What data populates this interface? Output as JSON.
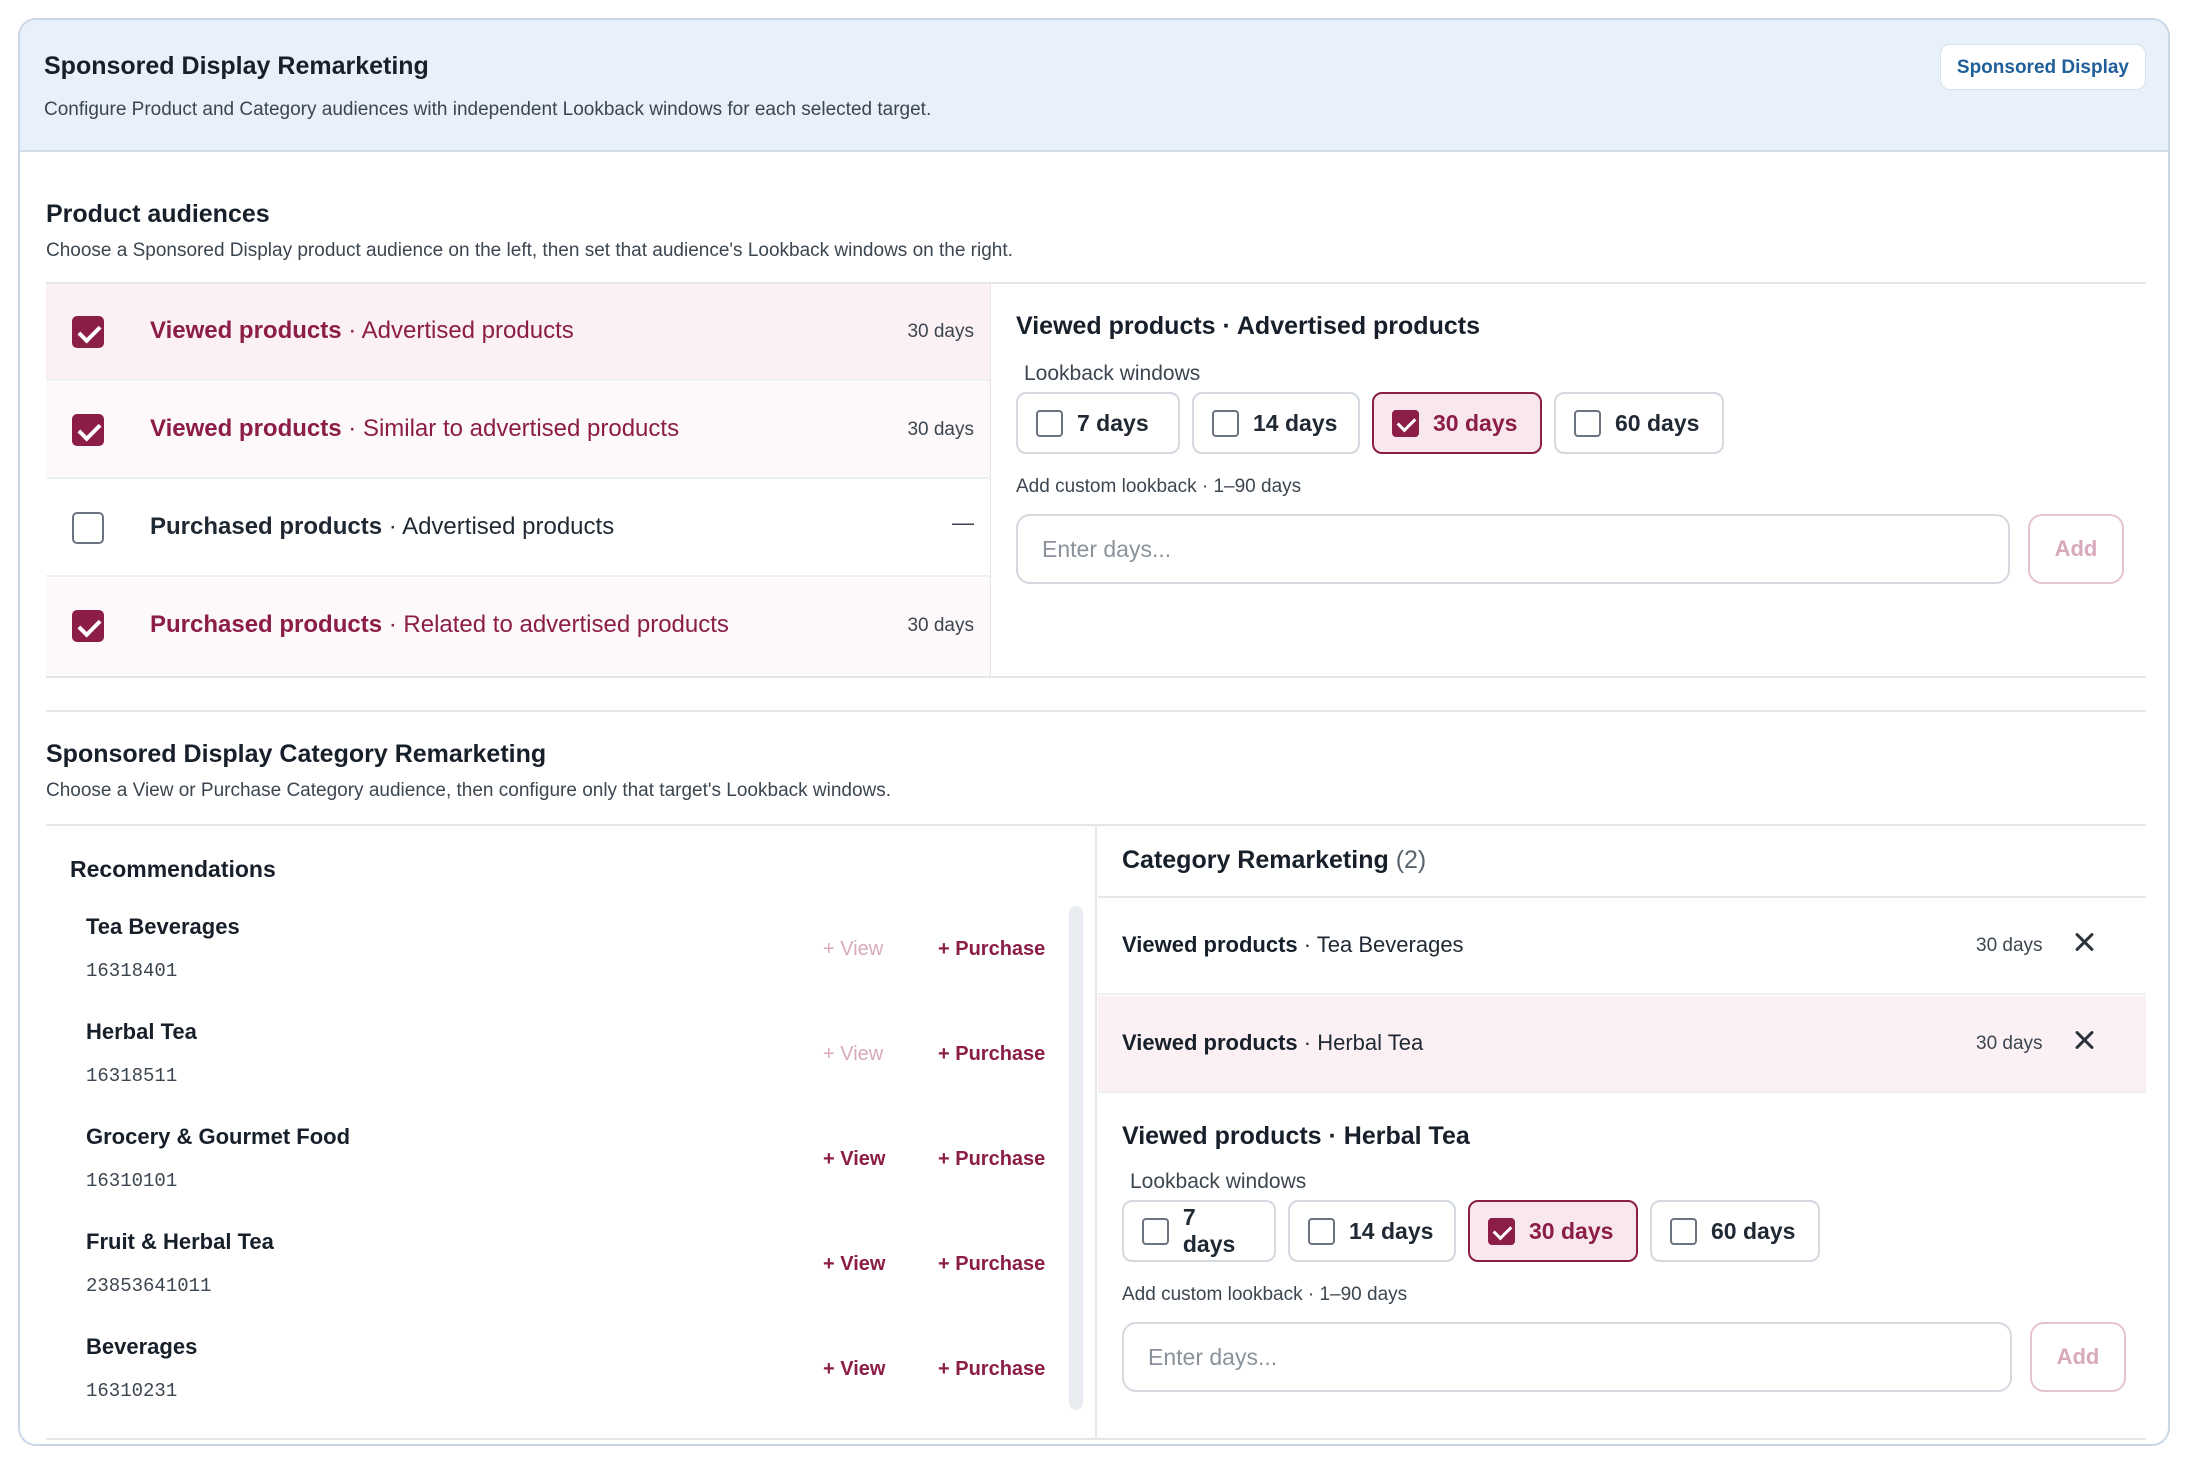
{
  "header": {
    "title": "Sponsored Display Remarketing",
    "subtitle": "Configure Product and Category audiences with independent Lookback windows for each selected target.",
    "badge": "Sponsored Display"
  },
  "product_audiences": {
    "title": "Product audiences",
    "subtitle": "Choose a Sponsored Display product audience on the left, then set that audience's Lookback windows on the right.",
    "rows": [
      {
        "type": "Viewed products",
        "separator": " · ",
        "target": "Advertised products",
        "days": "30 days",
        "checked": true
      },
      {
        "type": "Viewed products",
        "separator": " · ",
        "target": "Similar to advertised products",
        "days": "30 days",
        "checked": true
      },
      {
        "type": "Purchased products",
        "separator": " · ",
        "target": "Advertised products",
        "days": "—",
        "checked": false
      },
      {
        "type": "Purchased products",
        "separator": " · ",
        "target": "Related to advertised products",
        "days": "30 days",
        "checked": true
      }
    ],
    "detail": {
      "title": "Viewed products · Advertised products",
      "lookback_label": "Lookback windows",
      "options": [
        {
          "label": "7 days",
          "checked": false
        },
        {
          "label": "14 days",
          "checked": false
        },
        {
          "label": "30 days",
          "checked": true
        },
        {
          "label": "60 days",
          "checked": false
        }
      ],
      "custom_label": "Add custom lookback · 1–90 days",
      "placeholder": "Enter days...",
      "add_label": "Add"
    }
  },
  "category_remarketing": {
    "title": "Sponsored Display Category Remarketing",
    "subtitle": "Choose a View or Purchase Category audience, then configure only that target's Lookback windows.",
    "recommendations": {
      "title": "Recommendations",
      "view_label": "+ View",
      "purchase_label": "+ Purchase",
      "items": [
        {
          "name": "Tea Beverages",
          "id": "16318401",
          "view_added": true
        },
        {
          "name": "Herbal Tea",
          "id": "16318511",
          "view_added": true
        },
        {
          "name": "Grocery & Gourmet Food",
          "id": "16310101",
          "view_added": false
        },
        {
          "name": "Fruit & Herbal Tea",
          "id": "23853641011",
          "view_added": false
        },
        {
          "name": "Beverages",
          "id": "16310231",
          "view_added": false
        }
      ]
    },
    "selected": {
      "title": "Category Remarketing",
      "count": "(2)",
      "rows": [
        {
          "type": "Viewed products",
          "separator": " · ",
          "target": "Tea Beverages",
          "days": "30 days"
        },
        {
          "type": "Viewed products",
          "separator": " · ",
          "target": "Herbal Tea",
          "days": "30 days"
        }
      ]
    },
    "detail": {
      "title": "Viewed products · Herbal Tea",
      "lookback_label": "Lookback windows",
      "options": [
        {
          "label": "7 days",
          "checked": false
        },
        {
          "label": "14 days",
          "checked": false
        },
        {
          "label": "30 days",
          "checked": true
        },
        {
          "label": "60 days",
          "checked": false
        }
      ],
      "custom_label": "Add custom lookback · 1–90 days",
      "placeholder": "Enter days...",
      "add_label": "Add"
    }
  },
  "colors": {
    "accent": "#8b1d47",
    "accent_light": "#f8e8ee",
    "header_bg": "#e8f0f9",
    "badge_text": "#1f5f9a"
  }
}
